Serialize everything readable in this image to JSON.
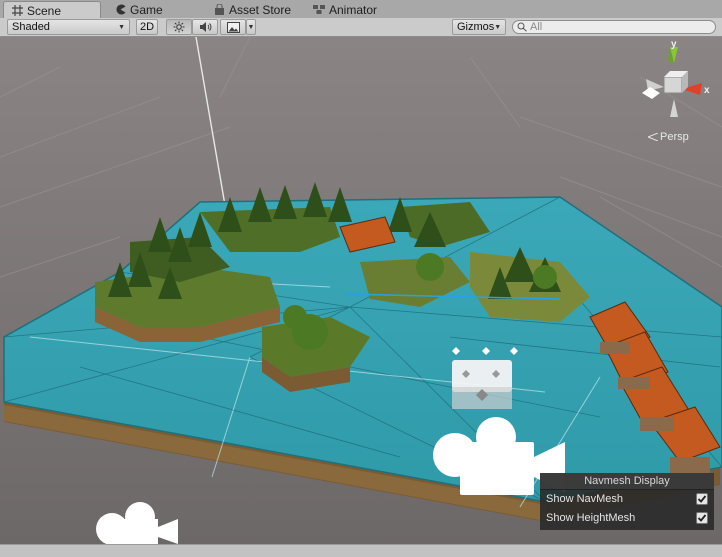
{
  "tabs": [
    {
      "label": "Scene",
      "icon": "grid-icon",
      "active": true
    },
    {
      "label": "Game",
      "icon": "pacman-icon",
      "active": false
    },
    {
      "label": "Asset Store",
      "icon": "shopping-bag-icon",
      "active": false
    },
    {
      "label": "Animator",
      "icon": "animator-icon",
      "active": false
    }
  ],
  "toolbar": {
    "draw_mode": "Shaded",
    "two_d": "2D",
    "lighting_icon": "sun-icon",
    "audio_icon": "speaker-icon",
    "effects_icon": "image-icon",
    "gizmos": "Gizmos",
    "search_placeholder": "All"
  },
  "viewport": {
    "projection": "Persp",
    "axes": {
      "y": "y",
      "x": "x"
    },
    "colors": {
      "background": "#7a7575",
      "navmesh": "#3fb3c2",
      "grass": "#5a7a2a",
      "dirt": "#8a6a3a",
      "axis_x": "#e0412a",
      "axis_y": "#8ac43a"
    }
  },
  "navmesh_display": {
    "title": "Navmesh Display",
    "options": [
      {
        "label": "Show NavMesh",
        "checked": true
      },
      {
        "label": "Show HeightMesh",
        "checked": true
      }
    ]
  }
}
